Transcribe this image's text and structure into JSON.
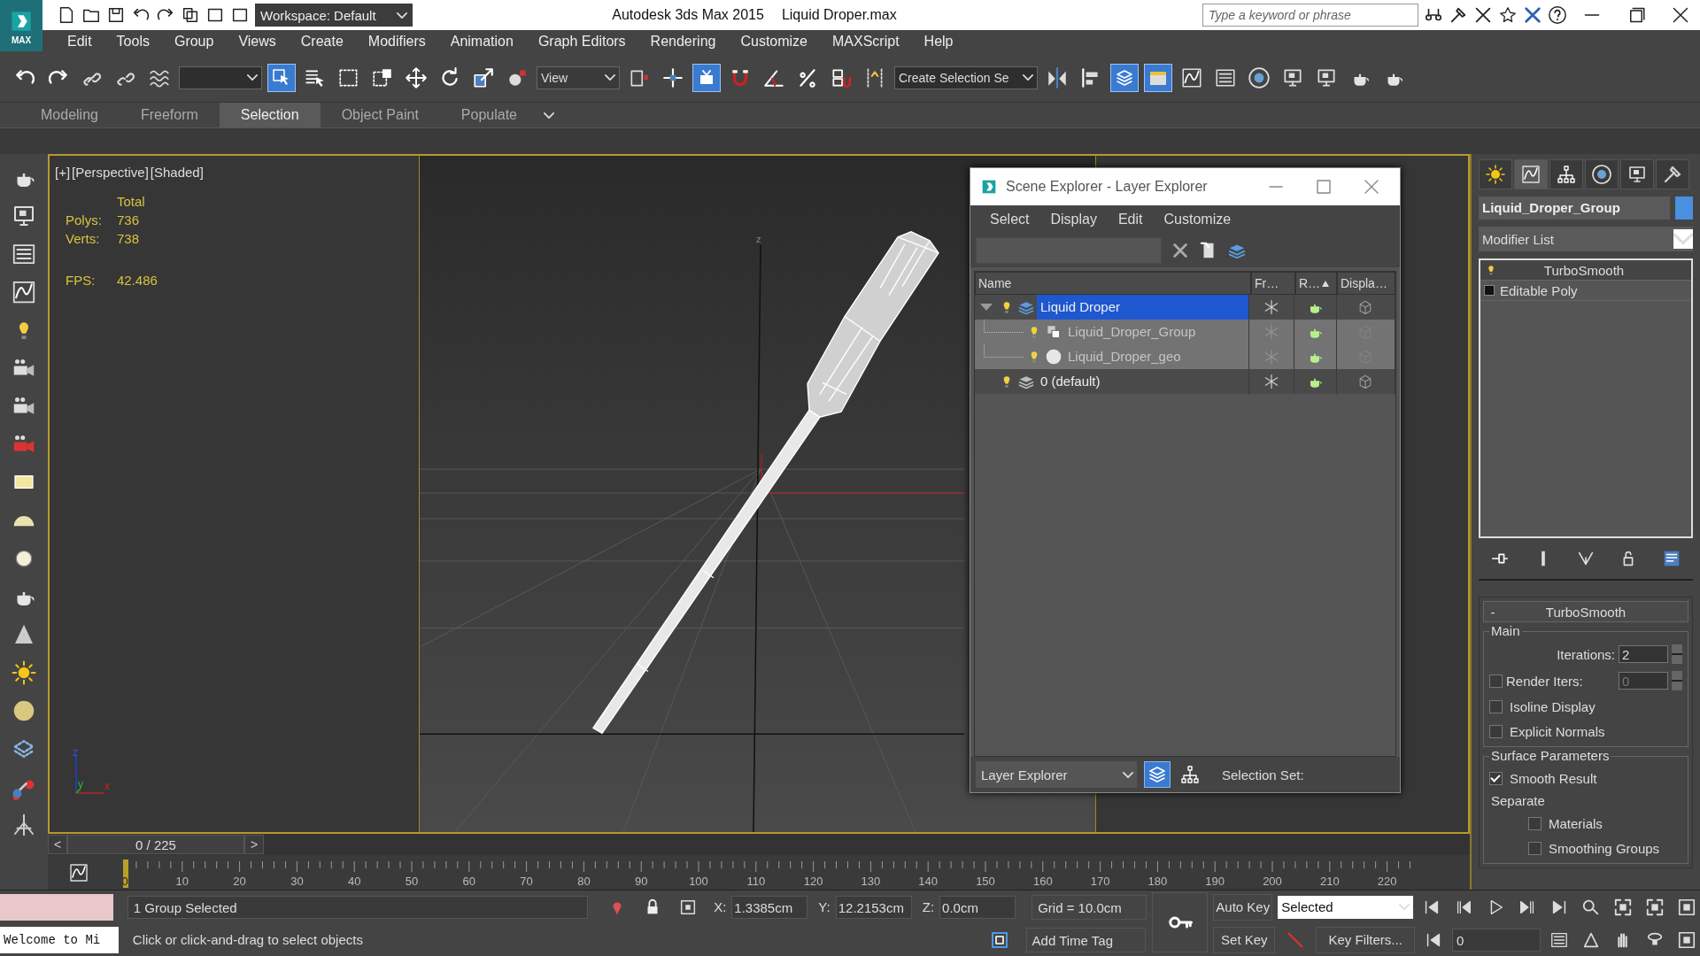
{
  "app_button": "MAX",
  "title_bar": {
    "workspace": "Workspace: Default",
    "title": "Autodesk 3ds Max 2015",
    "file": "Liquid Droper.max",
    "search": {
      "placeholder": "Type a keyword or phrase"
    }
  },
  "menu": [
    "Edit",
    "Tools",
    "Group",
    "Views",
    "Create",
    "Modifiers",
    "Animation",
    "Graph Editors",
    "Rendering",
    "Customize",
    "MAXScript",
    "Help"
  ],
  "toolbar": [
    {
      "kind": "icon",
      "on": false
    },
    {
      "kind": "icon",
      "on": false
    },
    {
      "kind": "icon",
      "on": false
    },
    {
      "kind": "icon",
      "on": false
    },
    {
      "kind": "icon",
      "on": false
    },
    {
      "kind": "dropdown"
    },
    {
      "kind": "icon",
      "on": true
    },
    {
      "kind": "icon",
      "on": false
    },
    {
      "kind": "icon",
      "on": false
    },
    {
      "kind": "icon",
      "on": false
    },
    {
      "kind": "icon",
      "on": false
    },
    {
      "kind": "icon",
      "on": false
    },
    {
      "kind": "icon",
      "on": false
    },
    {
      "kind": "icon",
      "on": false
    },
    {
      "kind": "dropdown",
      "value": "View"
    },
    {
      "kind": "icon",
      "on": false
    },
    {
      "kind": "icon",
      "on": false
    },
    {
      "kind": "icon",
      "on": true
    },
    {
      "kind": "icon",
      "on": false
    },
    {
      "kind": "icon",
      "on": false
    },
    {
      "kind": "icon",
      "on": false
    },
    {
      "kind": "icon",
      "on": false
    },
    {
      "kind": "icon",
      "on": false
    },
    {
      "kind": "dropdown",
      "value": "Create Selection Se"
    },
    {
      "kind": "icon",
      "on": false
    },
    {
      "kind": "icon",
      "on": false
    },
    {
      "kind": "icon",
      "on": true
    },
    {
      "kind": "icon",
      "on": true
    },
    {
      "kind": "icon",
      "on": false
    },
    {
      "kind": "icon",
      "on": false
    },
    {
      "kind": "icon",
      "on": false
    },
    {
      "kind": "icon",
      "on": false
    },
    {
      "kind": "icon",
      "on": false
    },
    {
      "kind": "icon",
      "on": false
    },
    {
      "kind": "icon",
      "on": false
    }
  ],
  "ribbon_tabs": [
    {
      "label": "Modeling",
      "selected": false
    },
    {
      "label": "Freeform",
      "selected": false
    },
    {
      "label": "Selection",
      "selected": true
    },
    {
      "label": "Object Paint",
      "selected": false
    },
    {
      "label": "Populate",
      "selected": false
    }
  ],
  "viewport": {
    "labels": [
      "[+]",
      "[Perspective]",
      "[Shaded]"
    ],
    "stats": {
      "header": "Total",
      "rows": [
        {
          "label": "Polys:",
          "value": "736"
        },
        {
          "label": "Verts:",
          "value": "738"
        }
      ],
      "fps_label": "FPS:",
      "fps": "42.486"
    },
    "axis_labels": [
      "z",
      "y",
      "x"
    ],
    "grid_axis_label": "z"
  },
  "scene_explorer": {
    "title": "Scene Explorer - Layer Explorer",
    "menu": [
      "Select",
      "Display",
      "Edit",
      "Customize"
    ],
    "columns": [
      "Name",
      "Fr…",
      "R…",
      "Displa…"
    ],
    "rows": [
      {
        "name": "Liquid Droper",
        "kind": "layer",
        "selected": true,
        "expanded": true,
        "children": [
          {
            "name": "Liquid_Droper_Group",
            "kind": "group",
            "selected": true
          },
          {
            "name": "Liquid_Droper_geo",
            "kind": "object",
            "selected": true
          }
        ]
      },
      {
        "name": "0 (default)",
        "kind": "layer",
        "selected": false,
        "expanded": false
      }
    ],
    "footer": {
      "mode": "Layer Explorer",
      "selection_set_label": "Selection Set:"
    }
  },
  "command_panel": {
    "tabs": [
      {
        "selected": false
      },
      {
        "selected": true
      },
      {
        "selected": false
      },
      {
        "selected": false
      },
      {
        "selected": false
      },
      {
        "selected": false
      }
    ],
    "object_name": "Liquid_Droper_Group",
    "modifier_list": "Modifier List",
    "stack": [
      {
        "label": "TurboSmooth",
        "kind": "modifier",
        "selected": true
      },
      {
        "label": "Editable Poly",
        "kind": "base",
        "selected": false
      }
    ],
    "rollout": {
      "collapse": "-",
      "title": "TurboSmooth",
      "main_group": "Main",
      "iterations": {
        "label": "Iterations:",
        "value": "2"
      },
      "render_iters": {
        "label": "Render Iters:",
        "value": "0",
        "checked": false
      },
      "isoline": {
        "label": "Isoline Display",
        "checked": false
      },
      "explicit_normals": {
        "label": "Explicit Normals",
        "checked": false
      },
      "surface_group": "Surface Parameters",
      "smooth_result": {
        "label": "Smooth Result",
        "checked": true
      },
      "separate_label": "Separate",
      "materials": {
        "label": "Materials",
        "checked": false
      },
      "smoothing_groups": {
        "label": "Smoothing Groups",
        "checked": false
      }
    }
  },
  "time_slider": {
    "prev": "<",
    "frame": "0 / 225",
    "level": 0,
    "next": ">"
  },
  "track_bar": {
    "labels": [
      "0",
      "10",
      "20",
      "30",
      "40",
      "50",
      "60",
      "70",
      "80",
      "90",
      "100",
      "110",
      "120",
      "130",
      "140",
      "150",
      "160",
      "170",
      "180",
      "190",
      "200",
      "210",
      "220"
    ]
  },
  "status_bar": {
    "maxscript_output": "Welcome to Mi",
    "selection_info": "1 Group Selected",
    "prompt": "Click or click-and-drag to select objects",
    "x_label": "X:",
    "x": "1.3385cm",
    "y_label": "Y:",
    "y": "12.2153cm",
    "z_label": "Z:",
    "z": "0.0cm",
    "grid": "Grid = 10.0cm",
    "add_time_tag": "Add Time Tag",
    "auto_key": "Auto Key",
    "set_key": "Set Key",
    "key_mode": "Selected",
    "key_filters": "Key Filters...",
    "current_frame": "0"
  }
}
